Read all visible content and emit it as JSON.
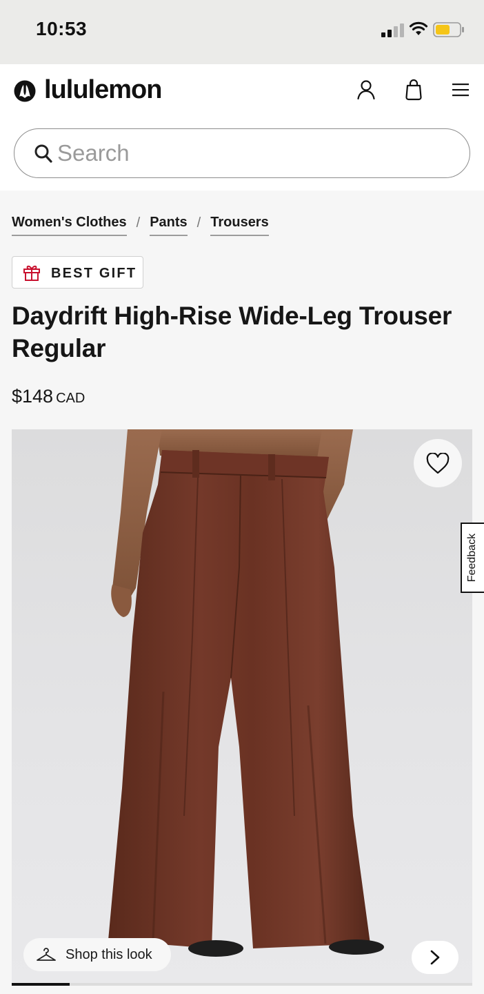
{
  "status_bar": {
    "time": "10:53"
  },
  "header": {
    "brand": "lululemon",
    "search": {
      "placeholder": "Search"
    }
  },
  "breadcrumb": [
    "Women's Clothes",
    "Pants",
    "Trousers"
  ],
  "badge": {
    "label": "BEST GIFT"
  },
  "product": {
    "title": "Daydrift High-Rise Wide-Leg Trouser Regular",
    "price": "$148",
    "currency": "CAD"
  },
  "gallery": {
    "shop_look_label": "Shop this look",
    "progress_fraction": 0.125
  },
  "feedback": {
    "label": "Feedback"
  },
  "colors": {
    "product_brown": "#6b3526",
    "badge_gift_red": "#c8102e",
    "text_primary": "#161616"
  },
  "icons": [
    "signal-icon",
    "wifi-icon",
    "battery-icon",
    "lululemon-logo-icon",
    "account-icon",
    "shopping-bag-icon",
    "menu-icon",
    "search-icon",
    "gift-icon",
    "heart-icon",
    "hanger-icon",
    "chevron-right-icon"
  ]
}
